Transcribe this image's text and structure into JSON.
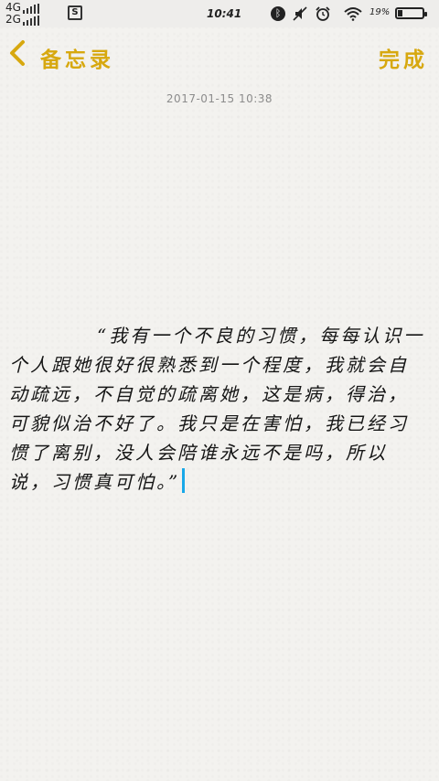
{
  "status_bar": {
    "network_top": "4G",
    "network_bottom": "2G",
    "time": "10:41",
    "battery_percent": "19%",
    "battery_level": 0.19
  },
  "nav": {
    "back_label": "备忘录",
    "done_label": "完成"
  },
  "note": {
    "timestamp": "2017-01-15 10:38",
    "content": "“我有一个不良的习惯，每每认识一个人跟她很好很熟悉到一个程度，我就会自动疏远，不自觉的疏离她，这是病，得治，可貌似治不好了。我只是在害怕，我已经习惯了离别，没人会陪谁永远不是吗，所以说，习惯真可怕。”"
  },
  "colors": {
    "accent": "#d7a80f",
    "caret": "#18a8e8",
    "background": "#f3f2ef"
  }
}
